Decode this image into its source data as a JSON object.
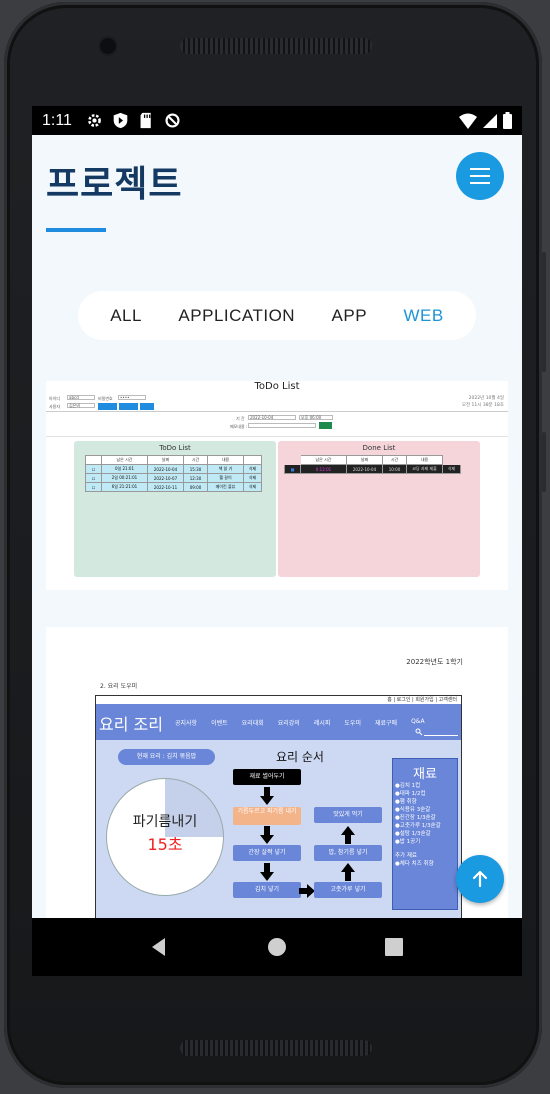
{
  "statusbar": {
    "time": "1:11"
  },
  "page": {
    "title": "프로젝트"
  },
  "filters": [
    {
      "label": "ALL"
    },
    {
      "label": "APPLICATION"
    },
    {
      "label": "APP"
    },
    {
      "label": "WEB",
      "active": true
    }
  ],
  "project1": {
    "title": "ToDo List",
    "id_label": "아이디",
    "id_value": "abcd",
    "pw_label": "비밀번호",
    "pw_value": "••••",
    "user_label": "사용자",
    "user_value": "김은비",
    "date_line1": "2022년 10월 4일",
    "date_line2": "오전 11시 38분 18초",
    "date_label": "기 간",
    "date_value": "2022-10-04",
    "time_value": "오후 06:00",
    "memo_label": "메모내용 :",
    "todo_panel": {
      "title": "ToDo List",
      "headers": [
        "남은 시간",
        "날짜",
        "시간",
        "내용",
        ""
      ],
      "rows": [
        [
          "0일 21:01",
          "2022-10-04",
          "15:30",
          "책 읽 기 ",
          "삭제"
        ],
        [
          "2일 00:21:01",
          "2022-10-07",
          "12:30",
          "헬 갈이",
          "삭제"
        ],
        [
          "6일 21:21:01",
          "2022-10-11",
          "09:00",
          "메이킨 플뷰",
          "삭제"
        ]
      ]
    },
    "done_panel": {
      "title": "Done List",
      "headers": [
        "남은 시간",
        "날짜",
        "시간",
        "내용",
        ""
      ],
      "rows": [
        [
          "0:12:01",
          "2022-10-04",
          "10:00",
          "코딩 과제 제출",
          "삭제"
        ]
      ]
    }
  },
  "project2": {
    "report_head": "2022학년도 1학기",
    "report_sub": "2. 요리 도우미",
    "top_links": "홈 | 로그인 | 회원가입 | 고객센터",
    "brand": "요리 조리",
    "menu": [
      "공지사항",
      "이벤트",
      "요리대회",
      "요리강의",
      "레시피",
      "도우미",
      "재료구매",
      "Q&A"
    ],
    "current_recipe": "현재 요리 : 김치 볶음밥",
    "steps_title": "요리 순서",
    "timer_label": "파기름내기",
    "timer_value": "15초",
    "steps": [
      "재료 썰어두기",
      "기름두르고 파기름 내기",
      "간장 살짝 넣기",
      "김치 넣기",
      "고춧가루 넣기",
      "밥, 참기름 넣기",
      "맛있게 먹기"
    ],
    "ingredients_title": "재료",
    "ingredients": [
      "●김치        1컵",
      "●대파      1/2컵",
      "●햄          취향",
      "●식용유    3숟갈",
      "●진간장   1/3숟갈",
      "●고춧가루 1/3숟갈",
      "●설탕      1/3숟갈",
      "●밥          1공기"
    ],
    "extra_title": "추가 재료",
    "extra_line": "●체다 치즈 취향"
  },
  "colors": {
    "accent": "#1a9ae0",
    "title": "#143a63",
    "active_filter": "#1e93d6"
  },
  "icons": {
    "menu": "hamburger-icon",
    "scroll_top": "arrow-up-icon",
    "nav": [
      "back-icon",
      "home-icon",
      "recents-icon"
    ]
  }
}
